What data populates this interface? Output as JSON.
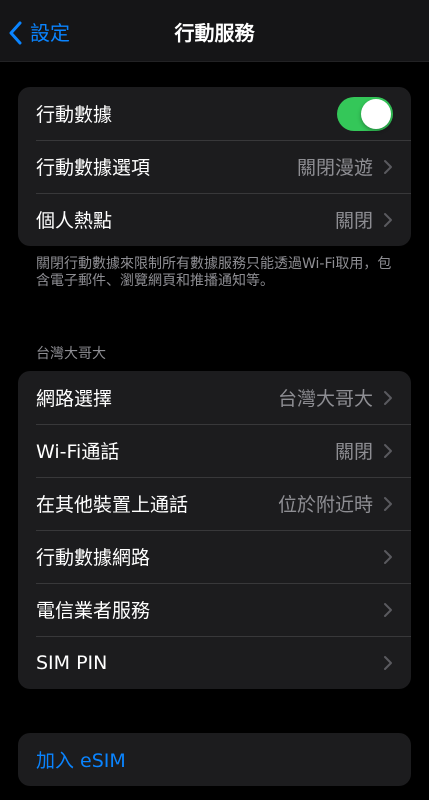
{
  "nav": {
    "back_label": "設定",
    "title": "行動服務"
  },
  "group1": {
    "cellular_data": {
      "label": "行動數據",
      "toggle_on": true
    },
    "cellular_data_options": {
      "label": "行動數據選項",
      "value": "關閉漫遊"
    },
    "personal_hotspot": {
      "label": "個人熱點",
      "value": "關閉"
    }
  },
  "footnote": "關閉行動數據來限制所有數據服務只能透過Wi-Fi取用，包含電子郵件、瀏覽網頁和推播通知等。",
  "carrier_section": {
    "header": "台灣大哥大",
    "items": [
      {
        "label": "網路選擇",
        "value": "台灣大哥大"
      },
      {
        "label": "Wi-Fi通話",
        "value": "關閉"
      },
      {
        "label": "在其他裝置上通話",
        "value": "位於附近時"
      },
      {
        "label": "行動數據網路",
        "value": ""
      },
      {
        "label": "電信業者服務",
        "value": ""
      },
      {
        "label": "SIM PIN",
        "value": ""
      }
    ]
  },
  "esim": {
    "label": "加入 eSIM"
  },
  "colors": {
    "accent": "#0a84ff",
    "toggle_on": "#34c759",
    "cell_background": "#1c1c1e",
    "secondary_text": "#8e8e93"
  }
}
